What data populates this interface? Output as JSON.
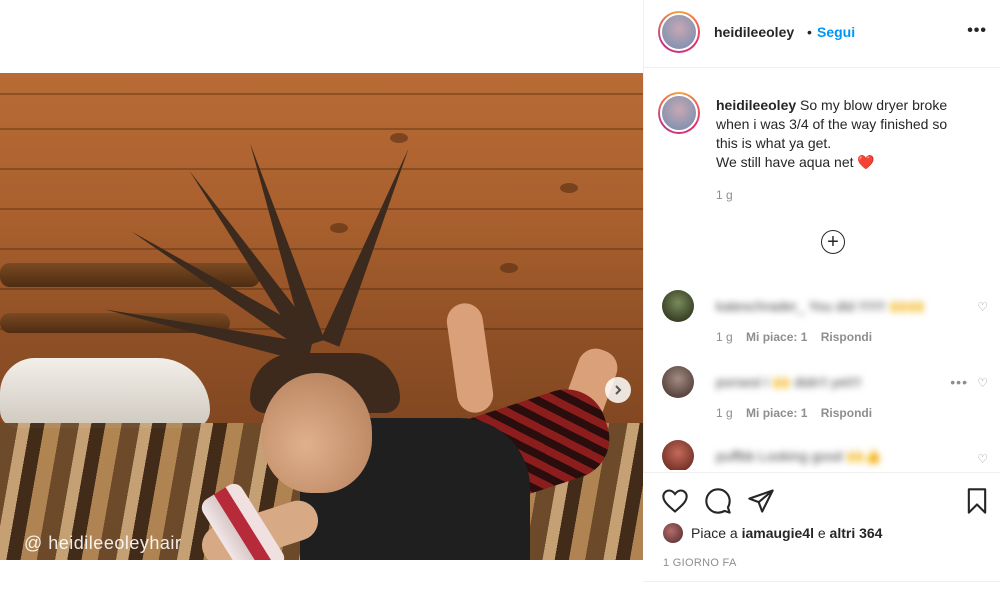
{
  "post": {
    "image_watermark": "@ heidileeoleyhair"
  },
  "header": {
    "username": "heidileeoley",
    "separator": "•",
    "follow_label": "Segui",
    "more_label": "•••"
  },
  "caption": {
    "username": "heidileeoley",
    "lines": [
      "So my blow dryer broke",
      "when i was 3/4 of the way finished so",
      "this is what ya get.",
      "We still have aqua net ❤️"
    ],
    "time": "1 g"
  },
  "comments": [
    {
      "text": "kateschrader_ You did !!!!!!! 🙌🙌",
      "time": "1 g",
      "likes": "Mi piace: 1",
      "reply": "Rispondi"
    },
    {
      "text": "porsesl I 🙌 didn't yet!!!",
      "time": "1 g",
      "likes": "Mi piace: 1",
      "reply": "Rispondi",
      "more": "•••"
    },
    {
      "text": "puffbb Looking good 🙌👍"
    }
  ],
  "actions": {
    "likes_prefix": "Piace a ",
    "liker": "iamaugie4l",
    "likes_middle": " e ",
    "likes_count": "altri 364",
    "date": "1 GIORNO FA"
  },
  "icons": [
    "heart-icon",
    "comment-icon",
    "share-icon",
    "bookmark-icon",
    "add-icon",
    "chevron-right-icon"
  ]
}
